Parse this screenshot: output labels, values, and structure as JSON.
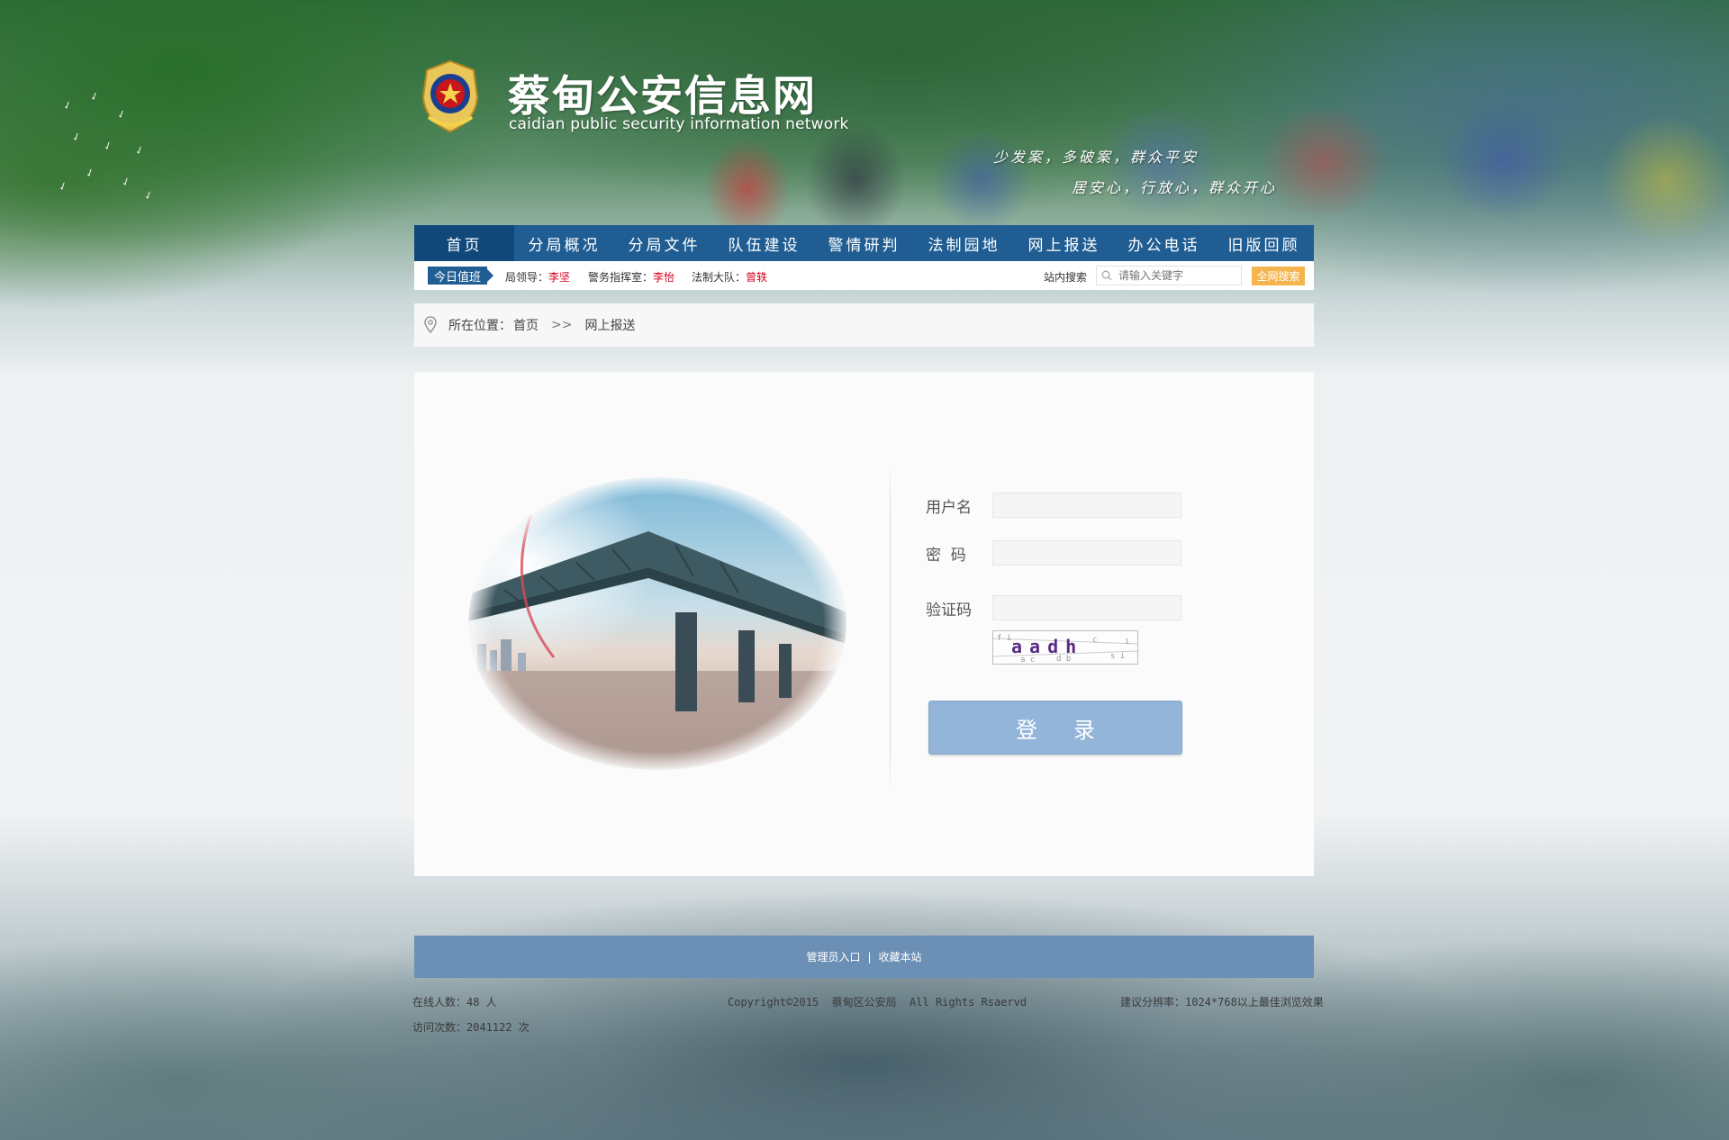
{
  "header": {
    "site_title": "蔡甸公安信息网",
    "site_subtitle": "caidian  public security information network",
    "slogan_line1": "少发案，多破案，群众平安",
    "slogan_line2": "居安心，行放心，群众开心"
  },
  "nav": {
    "items": [
      {
        "label": "首页",
        "active": true
      },
      {
        "label": "分局概况"
      },
      {
        "label": "分局文件"
      },
      {
        "label": "队伍建设"
      },
      {
        "label": "警情研判"
      },
      {
        "label": "法制园地"
      },
      {
        "label": "网上报送"
      },
      {
        "label": "办公电话"
      },
      {
        "label": "旧版回顾"
      }
    ]
  },
  "duty": {
    "badge": "今日值班",
    "entries": [
      {
        "title": "局领导：",
        "name": "李坚"
      },
      {
        "title": "警务指挥室：",
        "name": "李怡"
      },
      {
        "title": "法制大队：",
        "name": "曾轶"
      }
    ],
    "search_label": "站内搜索",
    "search_placeholder": "请输入关键字",
    "search_button": "全网搜索"
  },
  "breadcrumb": {
    "prefix": "所在位置：",
    "home": "首页",
    "separator": ">>",
    "current": "网上报送"
  },
  "login": {
    "username_label": "用户名",
    "username_value": "",
    "password_label": "密  码",
    "password_value": "",
    "captcha_label": "验证码",
    "captcha_value": "",
    "captcha_text": "aadh",
    "login_button": "登录"
  },
  "footer": {
    "admin_link": "管理员入口",
    "divider": "|",
    "favorite_link": "收藏本站",
    "online_count": "在线人数：48 人",
    "visit_count": "访问次数：2041122 次",
    "copyright": "Copyright©2015  蔡甸区公安局  All Rights Rsaervd",
    "resolution_tip": "建议分辨率：1024*768以上最佳浏览效果"
  },
  "colors": {
    "nav_bg": "#1f5d93",
    "nav_active": "#10487a",
    "search_button": "#f5b44d",
    "login_button": "#93b5d9",
    "footer_bar": "#6b8fb5",
    "duty_name": "#d6001c"
  }
}
